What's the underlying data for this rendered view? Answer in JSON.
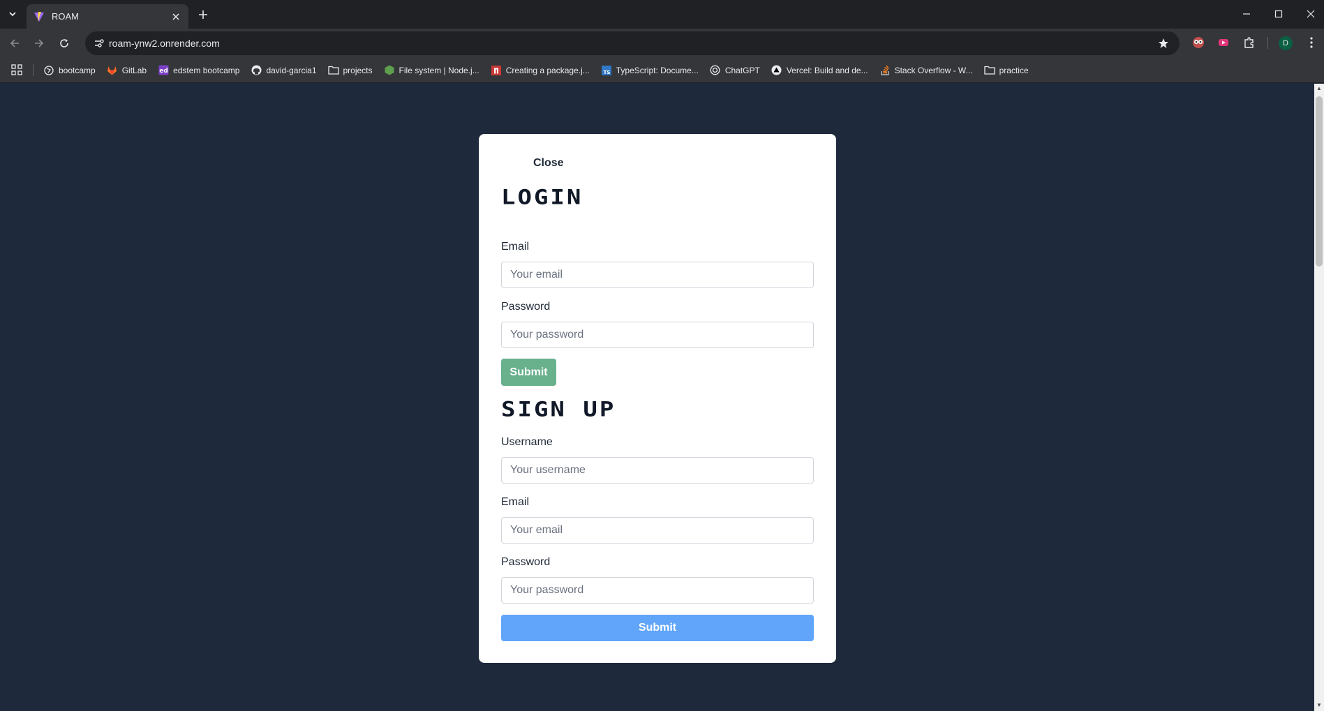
{
  "browser": {
    "tab_title": "ROAM",
    "url": "roam-ynw2.onrender.com",
    "profile_initial": "D",
    "bookmarks": [
      {
        "label": "bootcamp",
        "icon": "globe-icon"
      },
      {
        "label": "GitLab",
        "icon": "gitlab-icon"
      },
      {
        "label": "edstem bootcamp",
        "icon": "edstem-icon"
      },
      {
        "label": "david-garcia1",
        "icon": "github-icon"
      },
      {
        "label": "projects",
        "icon": "folder-icon"
      },
      {
        "label": "File system | Node.j...",
        "icon": "nodejs-icon"
      },
      {
        "label": "Creating a package.j...",
        "icon": "npm-icon"
      },
      {
        "label": "TypeScript: Docume...",
        "icon": "typescript-icon"
      },
      {
        "label": "ChatGPT",
        "icon": "chatgpt-icon"
      },
      {
        "label": "Vercel: Build and de...",
        "icon": "vercel-icon"
      },
      {
        "label": "Stack Overflow - W...",
        "icon": "stackoverflow-icon"
      },
      {
        "label": "practice",
        "icon": "folder-icon"
      }
    ]
  },
  "modal": {
    "close_label": "Close",
    "login": {
      "heading": "LOGIN",
      "email_label": "Email",
      "email_placeholder": "Your email",
      "password_label": "Password",
      "password_placeholder": "Your password",
      "submit_label": "Submit"
    },
    "signup": {
      "heading": "SIGN UP",
      "username_label": "Username",
      "username_placeholder": "Your username",
      "email_label": "Email",
      "email_placeholder": "Your email",
      "password_label": "Password",
      "password_placeholder": "Your password",
      "submit_label": "Submit"
    }
  },
  "colors": {
    "page_background": "#1e293b",
    "login_submit": "#69b08d",
    "signup_submit": "#60a5fa"
  }
}
